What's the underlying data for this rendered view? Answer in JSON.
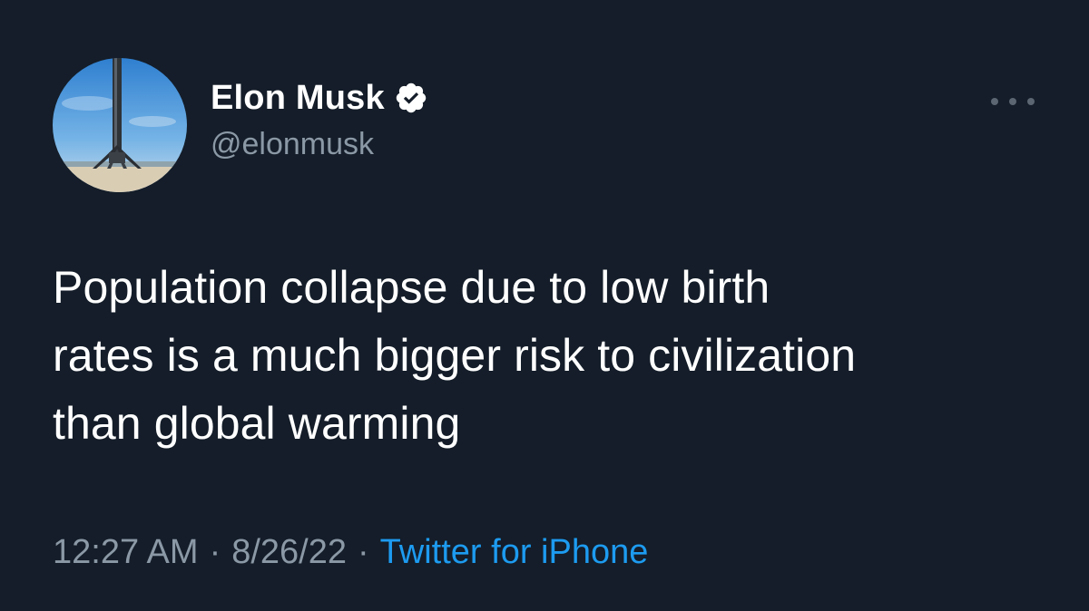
{
  "author": {
    "display_name": "Elon Musk",
    "handle": "@elonmusk",
    "verified": true,
    "avatar_icon": "rocket-booster-avatar"
  },
  "tweet": {
    "lines": [
      "Population collapse due to low birth",
      "rates is a much bigger risk to civilization",
      "than global warming"
    ]
  },
  "meta": {
    "time": "12:27 AM",
    "separator": "·",
    "date": "8/26/22",
    "source": "Twitter for iPhone"
  },
  "colors": {
    "background": "#141d29",
    "text": "#ffffff",
    "secondary": "#8b98a5",
    "link": "#1d9bf0"
  }
}
